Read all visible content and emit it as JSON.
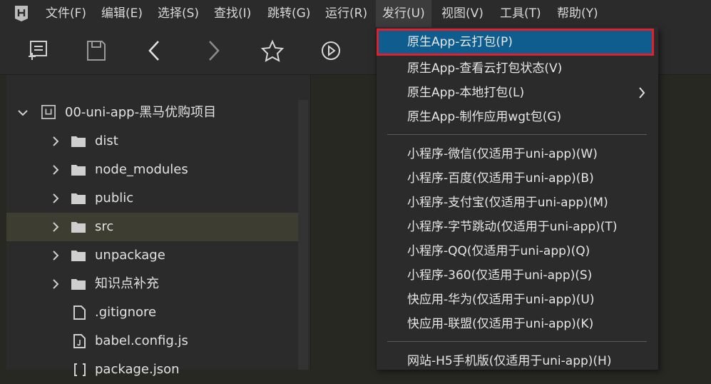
{
  "menubar": {
    "items": [
      "文件(F)",
      "编辑(E)",
      "选择(S)",
      "查找(I)",
      "跳转(G)",
      "运行(R)",
      "发行(U)",
      "视图(V)",
      "工具(T)",
      "帮助(Y)"
    ],
    "active": "发行(U)"
  },
  "toolbar": {
    "icons": [
      "new-file-icon",
      "save-icon",
      "back-icon",
      "forward-icon",
      "star-icon",
      "run-icon"
    ]
  },
  "project": {
    "root": "00-uni-app-黑马优购项目",
    "items": [
      {
        "label": "dist",
        "kind": "folder"
      },
      {
        "label": "node_modules",
        "kind": "folder"
      },
      {
        "label": "public",
        "kind": "folder"
      },
      {
        "label": "src",
        "kind": "folder",
        "selected": true
      },
      {
        "label": "unpackage",
        "kind": "folder"
      },
      {
        "label": "知识点补充",
        "kind": "folder"
      },
      {
        "label": ".gitignore",
        "kind": "file"
      },
      {
        "label": "babel.config.js",
        "kind": "file"
      },
      {
        "label": "package.json",
        "kind": "file"
      }
    ]
  },
  "publish_menu": {
    "items": [
      {
        "label": "原生App-云打包(P)",
        "highlighted": true
      },
      {
        "label": "原生App-查看云打包状态(V)"
      },
      {
        "label": "原生App-本地打包(L)",
        "submenu": true
      },
      {
        "label": "原生App-制作应用wgt包(G)"
      },
      {
        "label": "小程序-微信(仅适用于uni-app)(W)"
      },
      {
        "label": "小程序-百度(仅适用于uni-app)(B)"
      },
      {
        "label": "小程序-支付宝(仅适用于uni-app)(M)"
      },
      {
        "label": "小程序-字节跳动(仅适用于uni-app)(T)"
      },
      {
        "label": "小程序-QQ(仅适用于uni-app)(Q)"
      },
      {
        "label": "小程序-360(仅适用于uni-app)(S)"
      },
      {
        "label": "快应用-华为(仅适用于uni-app)(U)"
      },
      {
        "label": "快应用-联盟(仅适用于uni-app)(K)"
      },
      {
        "label": "网站-H5手机版(仅适用于uni-app)(H)"
      }
    ]
  },
  "colors": {
    "highlight_bg": "#0f5d8f",
    "highlight_border": "#e0202a",
    "selected_row": "#3e3d32"
  }
}
